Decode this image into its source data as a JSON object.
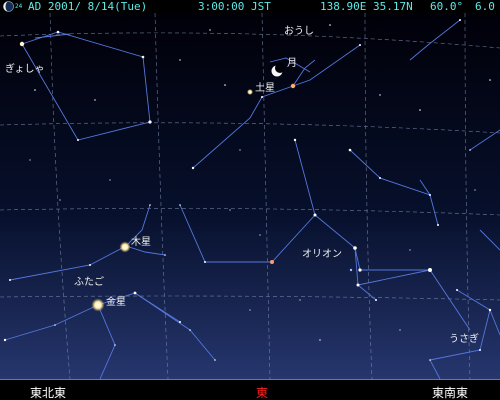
{
  "status": {
    "moon_age": "24",
    "date": "AD 2001/ 8/14(Tue)",
    "time": "3:00:00 JST",
    "location": "138.90E 35.17N",
    "field_of_view": "60.0°",
    "limiting_magnitude": "6.0"
  },
  "labels": {
    "auriga": "ぎょしゃ",
    "perseus": "おうし",
    "moon": "月",
    "saturn": "土星",
    "jupiter": "木星",
    "gemini": "ふたご",
    "venus": "金星",
    "orion": "オリオン",
    "lepus": "うさぎ"
  },
  "compass": {
    "left": "東北東",
    "center": "東",
    "right": "東南東"
  },
  "colors": {
    "status_text": "#5fe8e8",
    "constellation_line": "#5577dd",
    "grid_line": "#7f8fb2",
    "center_direction": "#ff2020"
  }
}
